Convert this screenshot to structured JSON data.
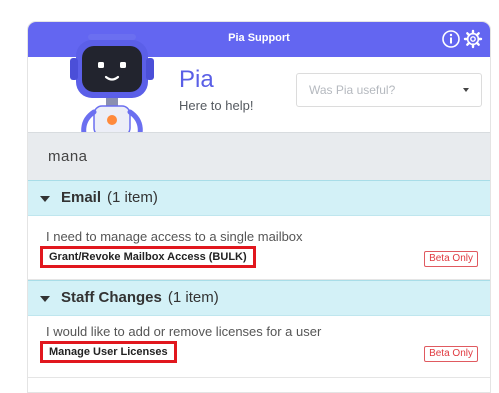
{
  "titlebar": {
    "title": "Pia Support"
  },
  "bot": {
    "name": "Pia",
    "tagline": "Here to help!"
  },
  "feedback": {
    "selected": "Was Pia useful?"
  },
  "search": {
    "query": "mana"
  },
  "groups": [
    {
      "title": "Email",
      "count": "(1 item)",
      "items": [
        {
          "description": "I need to manage access to a single mailbox",
          "name": "Grant/Revoke Mailbox Access (BULK)",
          "badge": "Beta Only"
        }
      ]
    },
    {
      "title": "Staff Changes",
      "count": "(1 item)",
      "items": [
        {
          "description": "I would like to add or remove licenses for a user",
          "name": "Manage User Licenses",
          "badge": "Beta Only"
        }
      ]
    }
  ],
  "colors": {
    "brand": "#6366f1",
    "group_bg": "#d3f1f7",
    "highlight": "#e1171e",
    "badge": "#e03a40"
  }
}
